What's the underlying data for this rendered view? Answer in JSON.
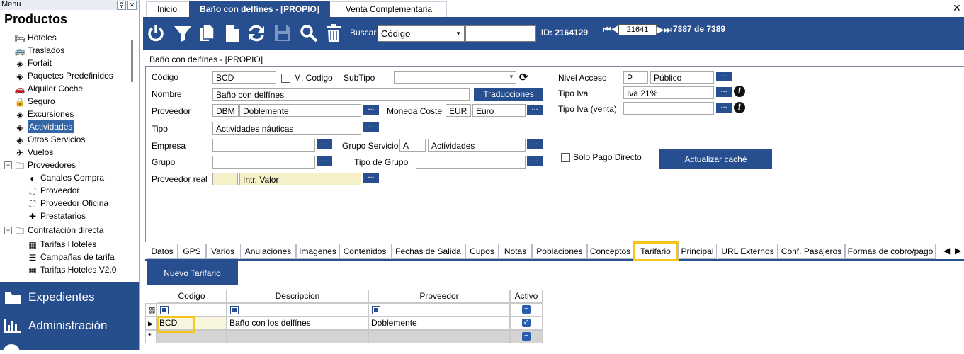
{
  "menu": {
    "title": "Menu",
    "pin_icon": "pin-icon",
    "close_icon": "close-icon"
  },
  "sidebar": {
    "title": "Productos",
    "items": [
      {
        "label": "Hoteles",
        "icon": "bed-icon"
      },
      {
        "label": "Traslados",
        "icon": "bus-icon"
      },
      {
        "label": "Forfait",
        "icon": "ticket-icon"
      },
      {
        "label": "Paquetes Predefinidos",
        "icon": "ticket-icon"
      },
      {
        "label": "Alquiler Coche",
        "icon": "car-icon"
      },
      {
        "label": "Seguro",
        "icon": "lock-icon"
      },
      {
        "label": "Excursiones",
        "icon": "ticket-icon"
      },
      {
        "label": "Actividades",
        "icon": "ticket-icon"
      },
      {
        "label": "Otros Servicios",
        "icon": "ticket-icon"
      },
      {
        "label": "Vuelos",
        "icon": "plane-icon"
      },
      {
        "label": "Proveedores",
        "icon": "folder-icon"
      },
      {
        "label": "Canales Compra",
        "icon": "signal-icon"
      },
      {
        "label": "Proveedor",
        "icon": "org-icon"
      },
      {
        "label": "Proveedor Oficina",
        "icon": "org-icon"
      },
      {
        "label": "Prestatarios",
        "icon": "puzzle-icon"
      },
      {
        "label": "Contratación directa",
        "icon": "folder-icon"
      },
      {
        "label": "Tarifas Hoteles",
        "icon": "calendar-icon"
      },
      {
        "label": "Campañas de tarifa",
        "icon": "list-icon"
      },
      {
        "label": "Tarifas Hoteles V2.0",
        "icon": "calendar-icon"
      }
    ],
    "nav": [
      {
        "label": "Expedientes",
        "icon": "folder-icon"
      },
      {
        "label": "Administración",
        "icon": "bar-chart-icon"
      }
    ]
  },
  "tabs": [
    {
      "label": "Inicio"
    },
    {
      "label": "Baño con delfínes - [PROPIO]"
    },
    {
      "label": "Venta Complementaria"
    }
  ],
  "toolbar": {
    "search_label": "Buscar",
    "search_field": "Código",
    "search_value": "",
    "id_text": "ID: 2164129",
    "record_number": "21641",
    "record_count": "7387 de 7389"
  },
  "doc_tab": "Baño con delfínes - [PROPIO]",
  "form": {
    "codigo_label": "Código",
    "codigo": "BCD",
    "mcodigo_label": "M. Codigo",
    "subtipo_label": "SubTipo",
    "subtipo": "",
    "nombre_label": "Nombre",
    "nombre": "Baño con delfínes",
    "traducciones": "Traducciones",
    "proveedor_label": "Proveedor",
    "proveedor_code": "DBM",
    "proveedor_name": "Doblemente",
    "moneda_label": "Moneda Coste",
    "moneda_code": "EUR",
    "moneda_name": "Euro",
    "tipo_label": "Tipo",
    "tipo": "Actividades náuticas",
    "empresa_label": "Empresa",
    "empresa": "",
    "gruposervicio_label": "Grupo Servicio",
    "gruposervicio_code": "A",
    "gruposervicio_name": "Actividades",
    "grupo_label": "Grupo",
    "grupo": "",
    "tipogrupo_label": "Tipo de Grupo",
    "tipogrupo": "",
    "provreal_label": "Proveedor real",
    "provreal_code": "",
    "provreal_name": "Intr. Valor",
    "nivel_label": "Nivel Acceso",
    "nivel_code": "P",
    "nivel_name": "Público",
    "tipoiva_label": "Tipo Iva",
    "tipoiva": "Iva 21%",
    "tipoiva_venta_label": "Tipo Iva (venta)",
    "tipoiva_venta": "",
    "solopago_label": "Solo Pago Directo",
    "actualizar": "Actualizar caché",
    "dots": "..."
  },
  "bottom_tabs": [
    "Datos",
    "GPS",
    "Varios",
    "Anulaciones",
    "Imagenes",
    "Contenidos",
    "Fechas de Salida",
    "Cupos",
    "Notas",
    "Poblaciones",
    "Conceptos",
    "Tarifario",
    "Principal",
    "URL Externos",
    "Conf. Pasajeros",
    "Formas de cobro/pago"
  ],
  "nuevo_tarifario": "Nuevo Tarifario",
  "grid": {
    "headers": [
      "Codigo",
      "Descripcion",
      "Proveedor",
      "Activo"
    ],
    "rows": [
      {
        "codigo": "BCD",
        "descripcion": "Baño con los delfínes",
        "proveedor": "Doblemente",
        "activo": true
      }
    ]
  },
  "colors": {
    "brand": "#274e8f",
    "highlight": "#f5c518",
    "sidebar_bottom": "#264d8c"
  }
}
